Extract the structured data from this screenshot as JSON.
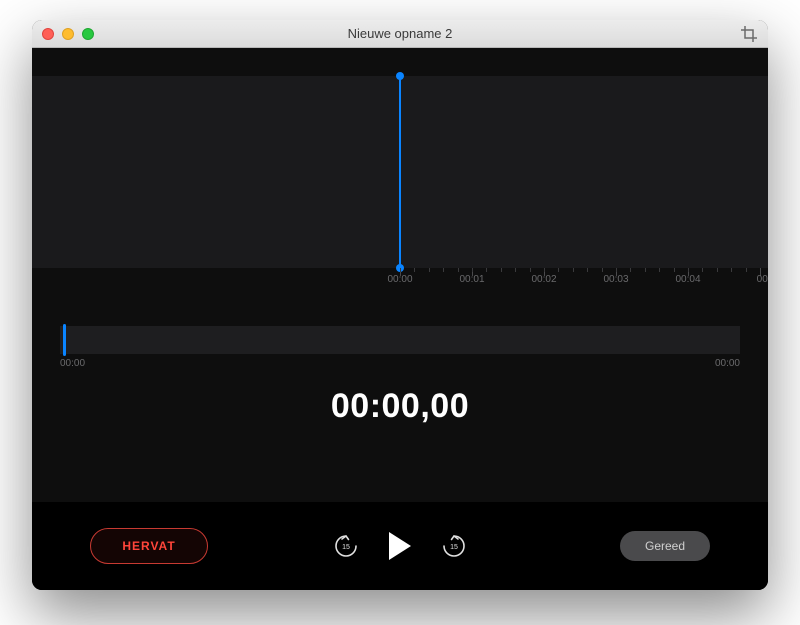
{
  "window": {
    "title": "Nieuwe opname 2"
  },
  "ruler": {
    "labels": [
      "00:00",
      "00:01",
      "00:02",
      "00:03",
      "00:04",
      "00"
    ]
  },
  "scrubber": {
    "start": "00:00",
    "end": "00:00"
  },
  "timer": "00:00,00",
  "controls": {
    "resume": "HERVAT",
    "done": "Gereed",
    "skip_seconds": "15"
  },
  "colors": {
    "accent": "#0a84ff",
    "danger": "#ff453a"
  }
}
